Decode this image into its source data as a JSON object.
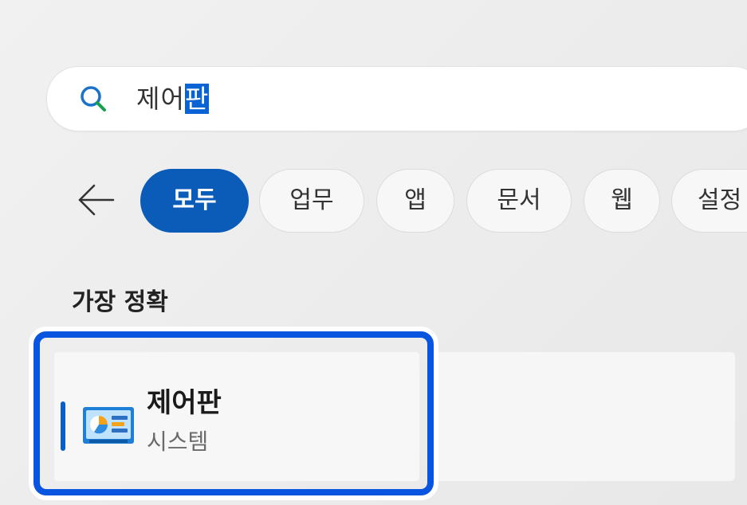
{
  "search": {
    "query_prefix": "제어",
    "query_selected": "판",
    "icon": "search-icon",
    "accent_color": "#0a63d4"
  },
  "filters": {
    "back_icon": "back-arrow-icon",
    "chips": [
      {
        "label": "모두",
        "active": true
      },
      {
        "label": "업무",
        "active": false
      },
      {
        "label": "앱",
        "active": false
      },
      {
        "label": "문서",
        "active": false
      },
      {
        "label": "웹",
        "active": false
      },
      {
        "label": "설정",
        "active": false
      }
    ],
    "active_color": "#0b5cb8"
  },
  "best_match": {
    "section_title": "가장 정확",
    "result": {
      "name": "제어판",
      "type": "시스템",
      "icon": "control-panel-icon"
    },
    "highlight_color": "#0a55e0"
  }
}
